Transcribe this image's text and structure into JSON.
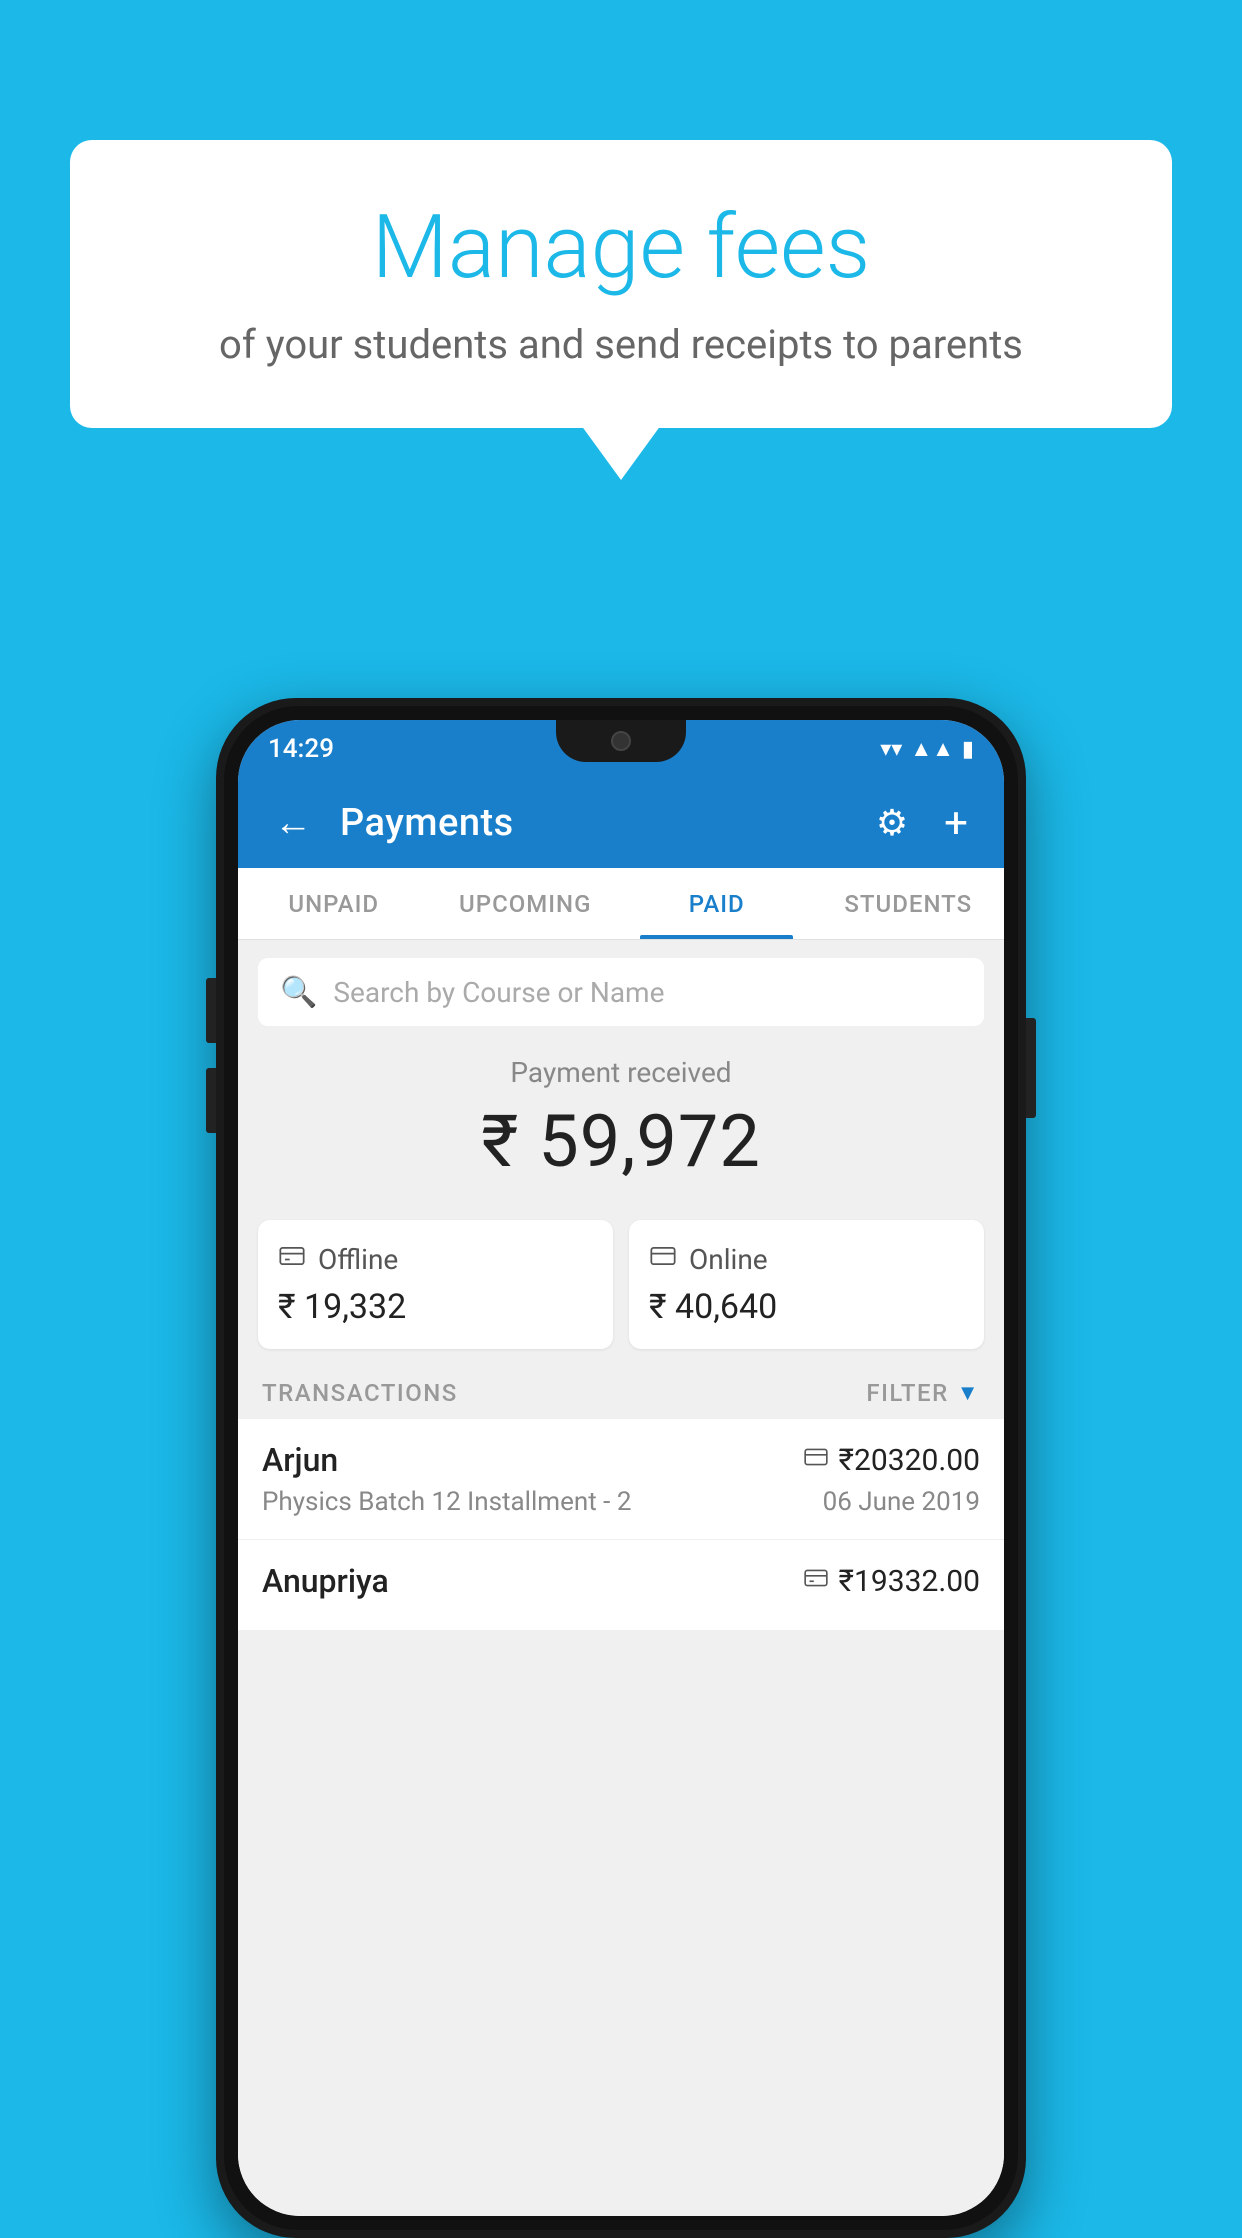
{
  "background_color": "#1bb8e8",
  "speech_bubble": {
    "title": "Manage fees",
    "subtitle": "of your students and send receipts to parents"
  },
  "status_bar": {
    "time": "14:29",
    "wifi": "▼",
    "signal": "▲",
    "battery": "▮"
  },
  "header": {
    "title": "Payments",
    "back_label": "←",
    "gear_label": "⚙",
    "plus_label": "+"
  },
  "tabs": [
    {
      "label": "UNPAID",
      "active": false
    },
    {
      "label": "UPCOMING",
      "active": false
    },
    {
      "label": "PAID",
      "active": true
    },
    {
      "label": "STUDENTS",
      "active": false
    }
  ],
  "search": {
    "placeholder": "Search by Course or Name"
  },
  "payment_summary": {
    "label": "Payment received",
    "amount": "₹ 59,972"
  },
  "payment_cards": [
    {
      "type": "Offline",
      "amount": "₹ 19,332",
      "icon": "💳"
    },
    {
      "type": "Online",
      "amount": "₹ 40,640",
      "icon": "💳"
    }
  ],
  "transactions_header": {
    "label": "TRANSACTIONS",
    "filter_label": "FILTER"
  },
  "transactions": [
    {
      "name": "Arjun",
      "course": "Physics Batch 12 Installment - 2",
      "amount": "₹20320.00",
      "date": "06 June 2019",
      "mode": "online"
    },
    {
      "name": "Anupriya",
      "course": "",
      "amount": "₹19332.00",
      "date": "",
      "mode": "offline"
    }
  ]
}
